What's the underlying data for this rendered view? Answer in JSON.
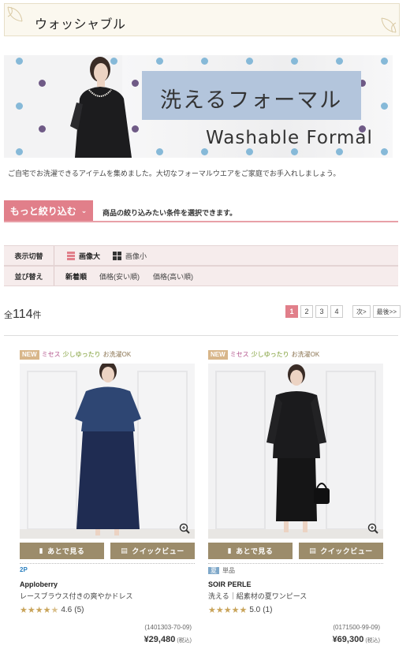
{
  "page": {
    "title": "ウォッシャブル"
  },
  "hero": {
    "title_jp": "洗えるフォーマル",
    "title_en": "Washable Formal"
  },
  "intro": "ご自宅でお洗濯できるアイテムを集めました。大切なフォーマルウエアをご家庭でお手入れしましょう。",
  "filter": {
    "button_label": "もっと絞り込む",
    "hint": "商品の絞り込みたい条件を選択できます。"
  },
  "view_toggle": {
    "label": "表示切替",
    "large": "画像大",
    "small": "画像小"
  },
  "sort": {
    "label": "並び替え",
    "options": [
      "新着順",
      "価格(安い順)",
      "価格(高い順)"
    ]
  },
  "results": {
    "prefix": "全",
    "count": "114",
    "suffix": "件"
  },
  "pagination": {
    "pages": [
      "1",
      "2",
      "3",
      "4"
    ],
    "next": "次>",
    "last": "最後>>"
  },
  "colors": {
    "accent": "#e17f8a",
    "button": "#9c8c6b",
    "star": "#c9a45a"
  },
  "products": [
    {
      "tags": {
        "new": "NEW",
        "missy": "ミセス",
        "fit": "少しゆったり",
        "wash": "お洗濯OK"
      },
      "btn_later": "あとで見る",
      "btn_quick": "クイックビュー",
      "badge": "2P",
      "brand": "Apploberry",
      "name": "レースブラウス付きの爽やかドレス",
      "rating": "4.6",
      "reviews": "(5)",
      "code": "(1401303-70-09)",
      "price": "¥29,480",
      "tax": "(税込)"
    },
    {
      "tags": {
        "new": "NEW",
        "missy": "ミセス",
        "fit": "少しゆったり",
        "wash": "お洗濯OK"
      },
      "btn_later": "あとで見る",
      "btn_quick": "クイックビュー",
      "season": "夏",
      "single": "単品",
      "brand": "SOIR PERLE",
      "name": "洗える｜絽素材の夏ワンピース",
      "rating": "5.0",
      "reviews": "(1)",
      "code": "(0171500-99-09)",
      "price": "¥69,300",
      "tax": "(税込)"
    }
  ]
}
